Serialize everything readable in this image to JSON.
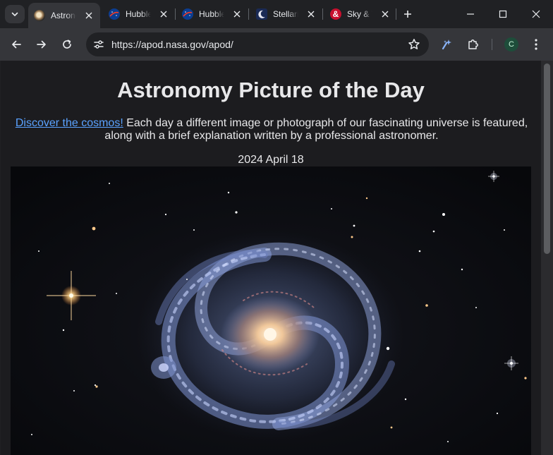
{
  "window": {
    "tabs": [
      {
        "title": "Astronomy Picture of the Day",
        "favicon": "apod-galaxy-icon",
        "active": true
      },
      {
        "title": "Hubble",
        "favicon": "nasa-meatball-icon",
        "active": false
      },
      {
        "title": "Hubble",
        "favicon": "nasa-meatball-icon",
        "active": false
      },
      {
        "title": "Stellarium",
        "favicon": "stellarium-moon-icon",
        "active": false
      },
      {
        "title": "Sky & Telescope",
        "favicon": "ampersand-icon",
        "active": false
      }
    ]
  },
  "toolbar": {
    "url": "https://apod.nasa.gov/apod/",
    "profile_initial": "C"
  },
  "page": {
    "title": "Astronomy Picture of the Day",
    "intro_link": "Discover the cosmos!",
    "intro_text": " Each day a different image or photograph of our fascinating universe is featured, along with a brief explanation written by a professional astronomer.",
    "date": "2024 April 18",
    "image_subject": "spiral-galaxy-image"
  },
  "colors": {
    "link": "#5aa2ff",
    "chrome_bg": "#202124",
    "toolbar_bg": "#35363a"
  }
}
